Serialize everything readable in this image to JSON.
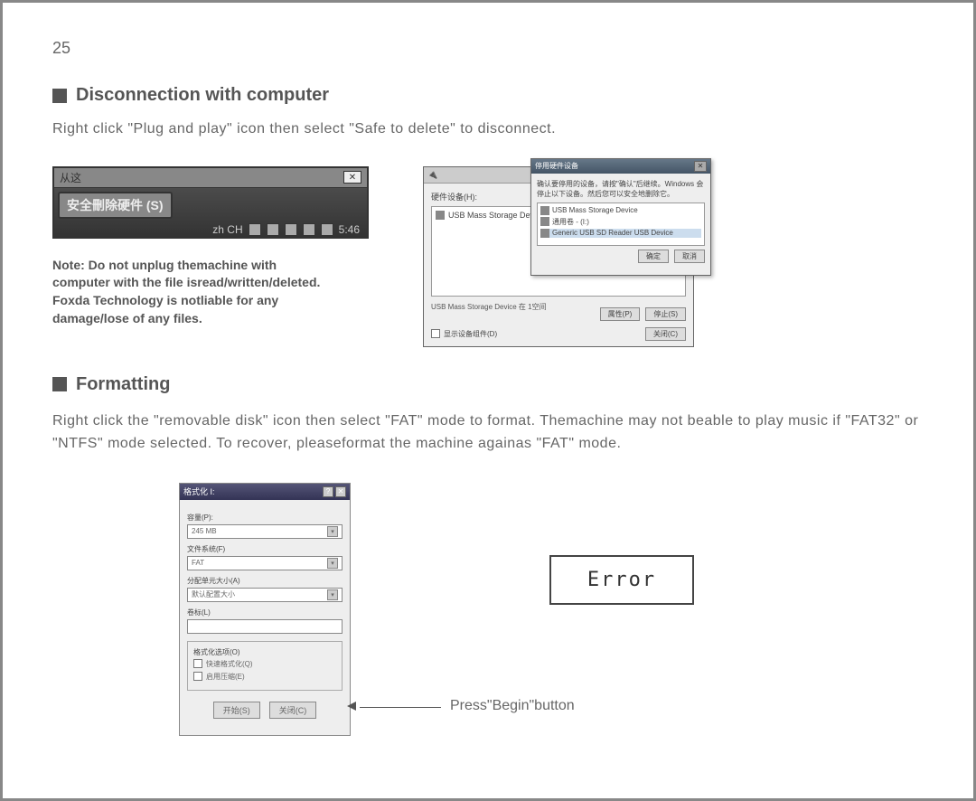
{
  "page_number": "25",
  "sections": {
    "disconnect": {
      "heading": "Disconnection with computer",
      "text": "Right click \"Plug and play\" icon then select \"Safe to delete\" to disconnect.",
      "note": "Note: Do not unplug themachine with computer with the file isread/written/deleted. Foxda Technology is notliable for any damage/lose of any files."
    },
    "formatting": {
      "heading": "Formatting",
      "text": "Right click the \"removable disk\" icon then select \"FAT\" mode to format. Themachine may not beable to play music if \"FAT32\" or \"NTFS\" mode selected. To recover, pleaseformat the machine againas \"FAT\" mode."
    }
  },
  "taskbar": {
    "top_label": "从这",
    "menu_item": "安全刪除硬件 (S)",
    "clock": "5:46"
  },
  "safe_remove_dialog": {
    "label": "硬件设备(H):",
    "list_item": "USB Mass Storage Device",
    "status": "USB Mass Storage Device 在 1空间",
    "popup_title": "停用硬件设备",
    "popup_text": "确认要停用的设备，请按\"确认\"后继续。Windows 会停止以下设备。然后您可以安全地删除它。",
    "popup_items": [
      "USB Mass Storage Device",
      "通用卷 - (I:)",
      "Generic USB SD Reader USB Device"
    ],
    "popup_ok": "确定",
    "popup_cancel": "取消",
    "btn_properties": "属性(P)",
    "btn_stop": "停止(S)",
    "checkbox": "显示设备组件(D)",
    "btn_close": "关闭(C)"
  },
  "format_dialog": {
    "title": "格式化 I:",
    "fields": {
      "capacity_label": "容量(P):",
      "capacity_value": "245 MB",
      "filesystem_label": "文件系统(F)",
      "filesystem_value": "FAT",
      "alloc_label": "分配单元大小(A)",
      "alloc_value": "默认配置大小",
      "volume_label": "卷标(L)",
      "volume_value": ""
    },
    "options_group": "格式化选项(O)",
    "options": [
      "快速格式化(Q)",
      "启用压缩(E)"
    ],
    "btn_begin": "开始(S)",
    "btn_close": "关闭(C)"
  },
  "press_begin_label": "Press\"Begin\"button",
  "error_box": "Error"
}
